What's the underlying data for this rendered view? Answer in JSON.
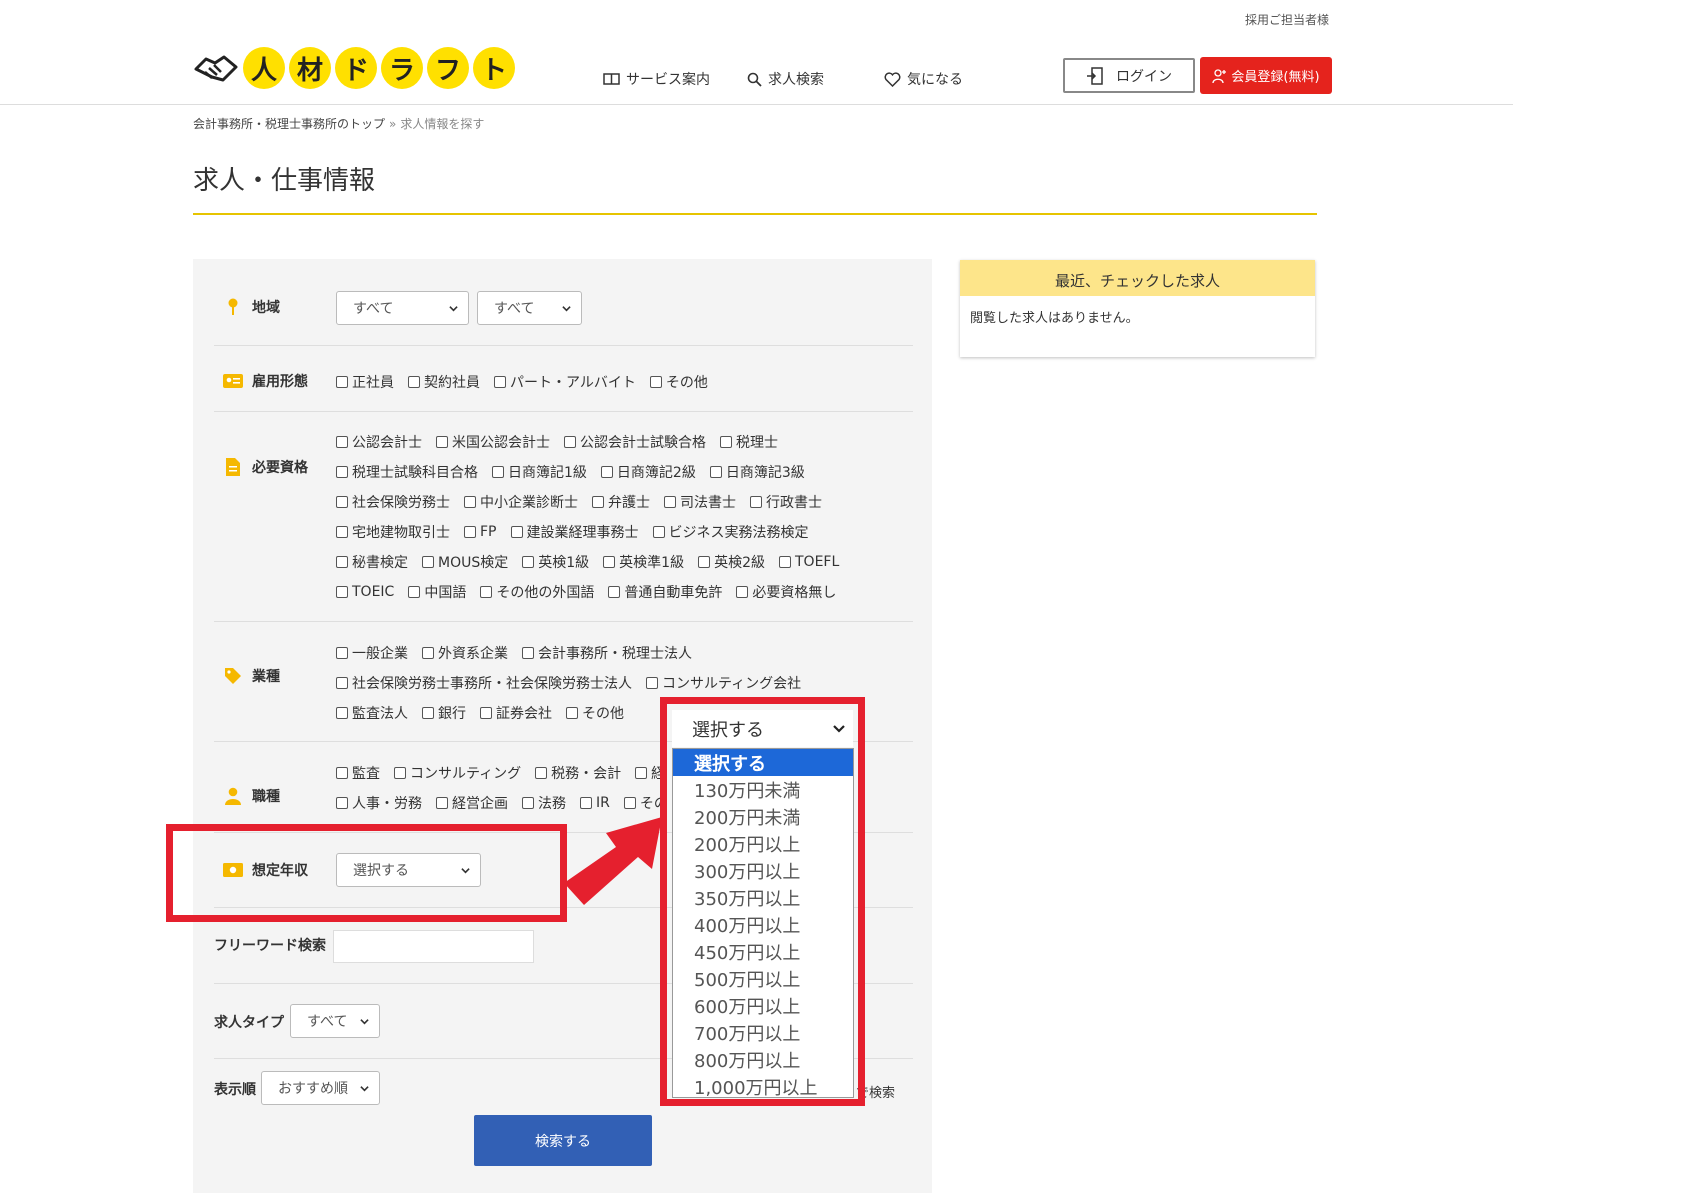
{
  "header": {
    "employer_link": "採用ご担当者様",
    "logo_chars": [
      "人",
      "材",
      "ド",
      "ラ",
      "フ",
      "ト"
    ],
    "nav": {
      "service": "サービス案内",
      "search": "求人検索",
      "favorite": "気になる"
    },
    "login_label": "ログイン",
    "register_label": "会員登録(無料)"
  },
  "breadcrumb": {
    "home": "会計事務所・税理士事務所のトップ",
    "separator": "»",
    "current": "求人情報を探す"
  },
  "page_title": "求人・仕事情報",
  "search": {
    "region": {
      "label": "地域",
      "select1": "すべて",
      "select2": "すべて"
    },
    "employment": {
      "label": "雇用形態",
      "options": [
        "正社員",
        "契約社員",
        "パート・アルバイト",
        "その他"
      ]
    },
    "qualification": {
      "label": "必要資格",
      "lines": [
        [
          "公認会計士",
          "米国公認会計士",
          "公認会計士試験合格",
          "税理士"
        ],
        [
          "税理士試験科目合格",
          "日商簿記1級",
          "日商簿記2級",
          "日商簿記3級"
        ],
        [
          "社会保険労務士",
          "中小企業診断士",
          "弁護士",
          "司法書士",
          "行政書士"
        ],
        [
          "宅地建物取引士",
          "FP",
          "建設業経理事務士",
          "ビジネス実務法務検定"
        ],
        [
          "秘書検定",
          "MOUS検定",
          "英検1級",
          "英検準1級",
          "英検2級",
          "TOEFL"
        ],
        [
          "TOEIC",
          "中国語",
          "その他の外国語",
          "普通自動車免許",
          "必要資格無し"
        ]
      ]
    },
    "industry": {
      "label": "業種",
      "lines": [
        [
          "一般企業",
          "外資系企業",
          "会計事務所・税理士法人"
        ],
        [
          "社会保険労務士事務所・社会保険労務士法人",
          "コンサルティング会社"
        ],
        [
          "監査法人",
          "銀行",
          "証券会社",
          "その他"
        ]
      ]
    },
    "job": {
      "label": "職種",
      "lines": [
        [
          "監査",
          "コンサルティング",
          "税務・会計",
          "経"
        ],
        [
          "人事・労務",
          "経営企画",
          "法務",
          "IR",
          "その"
        ]
      ]
    },
    "salary": {
      "label": "想定年収",
      "select": "選択する"
    },
    "freeword": {
      "label": "フリーワード検索",
      "placeholder": ""
    },
    "job_type": {
      "label": "求人タイプ",
      "select": "すべて"
    },
    "order": {
      "label": "表示順",
      "select": "おすすめ順"
    },
    "trailing_text": "で検索",
    "submit_label": "検索する"
  },
  "salary_dropdown": {
    "current": "選択する",
    "options": [
      "選択する",
      "130万円未満",
      "200万円未満",
      "200万円以上",
      "300万円以上",
      "350万円以上",
      "400万円以上",
      "450万円以上",
      "500万円以上",
      "600万円以上",
      "700万円以上",
      "800万円以上",
      "1,000万円以上"
    ],
    "selected_index": 0
  },
  "sidebar": {
    "recent_title": "最近、チェックした求人",
    "recent_empty": "閲覧した求人はありません。"
  },
  "colors": {
    "brand_yellow": "#ffe000",
    "accent_red": "#e5231d",
    "search_button": "#3260b5",
    "highlight_red": "#e5202e",
    "dropdown_selected": "#1d68d8"
  }
}
